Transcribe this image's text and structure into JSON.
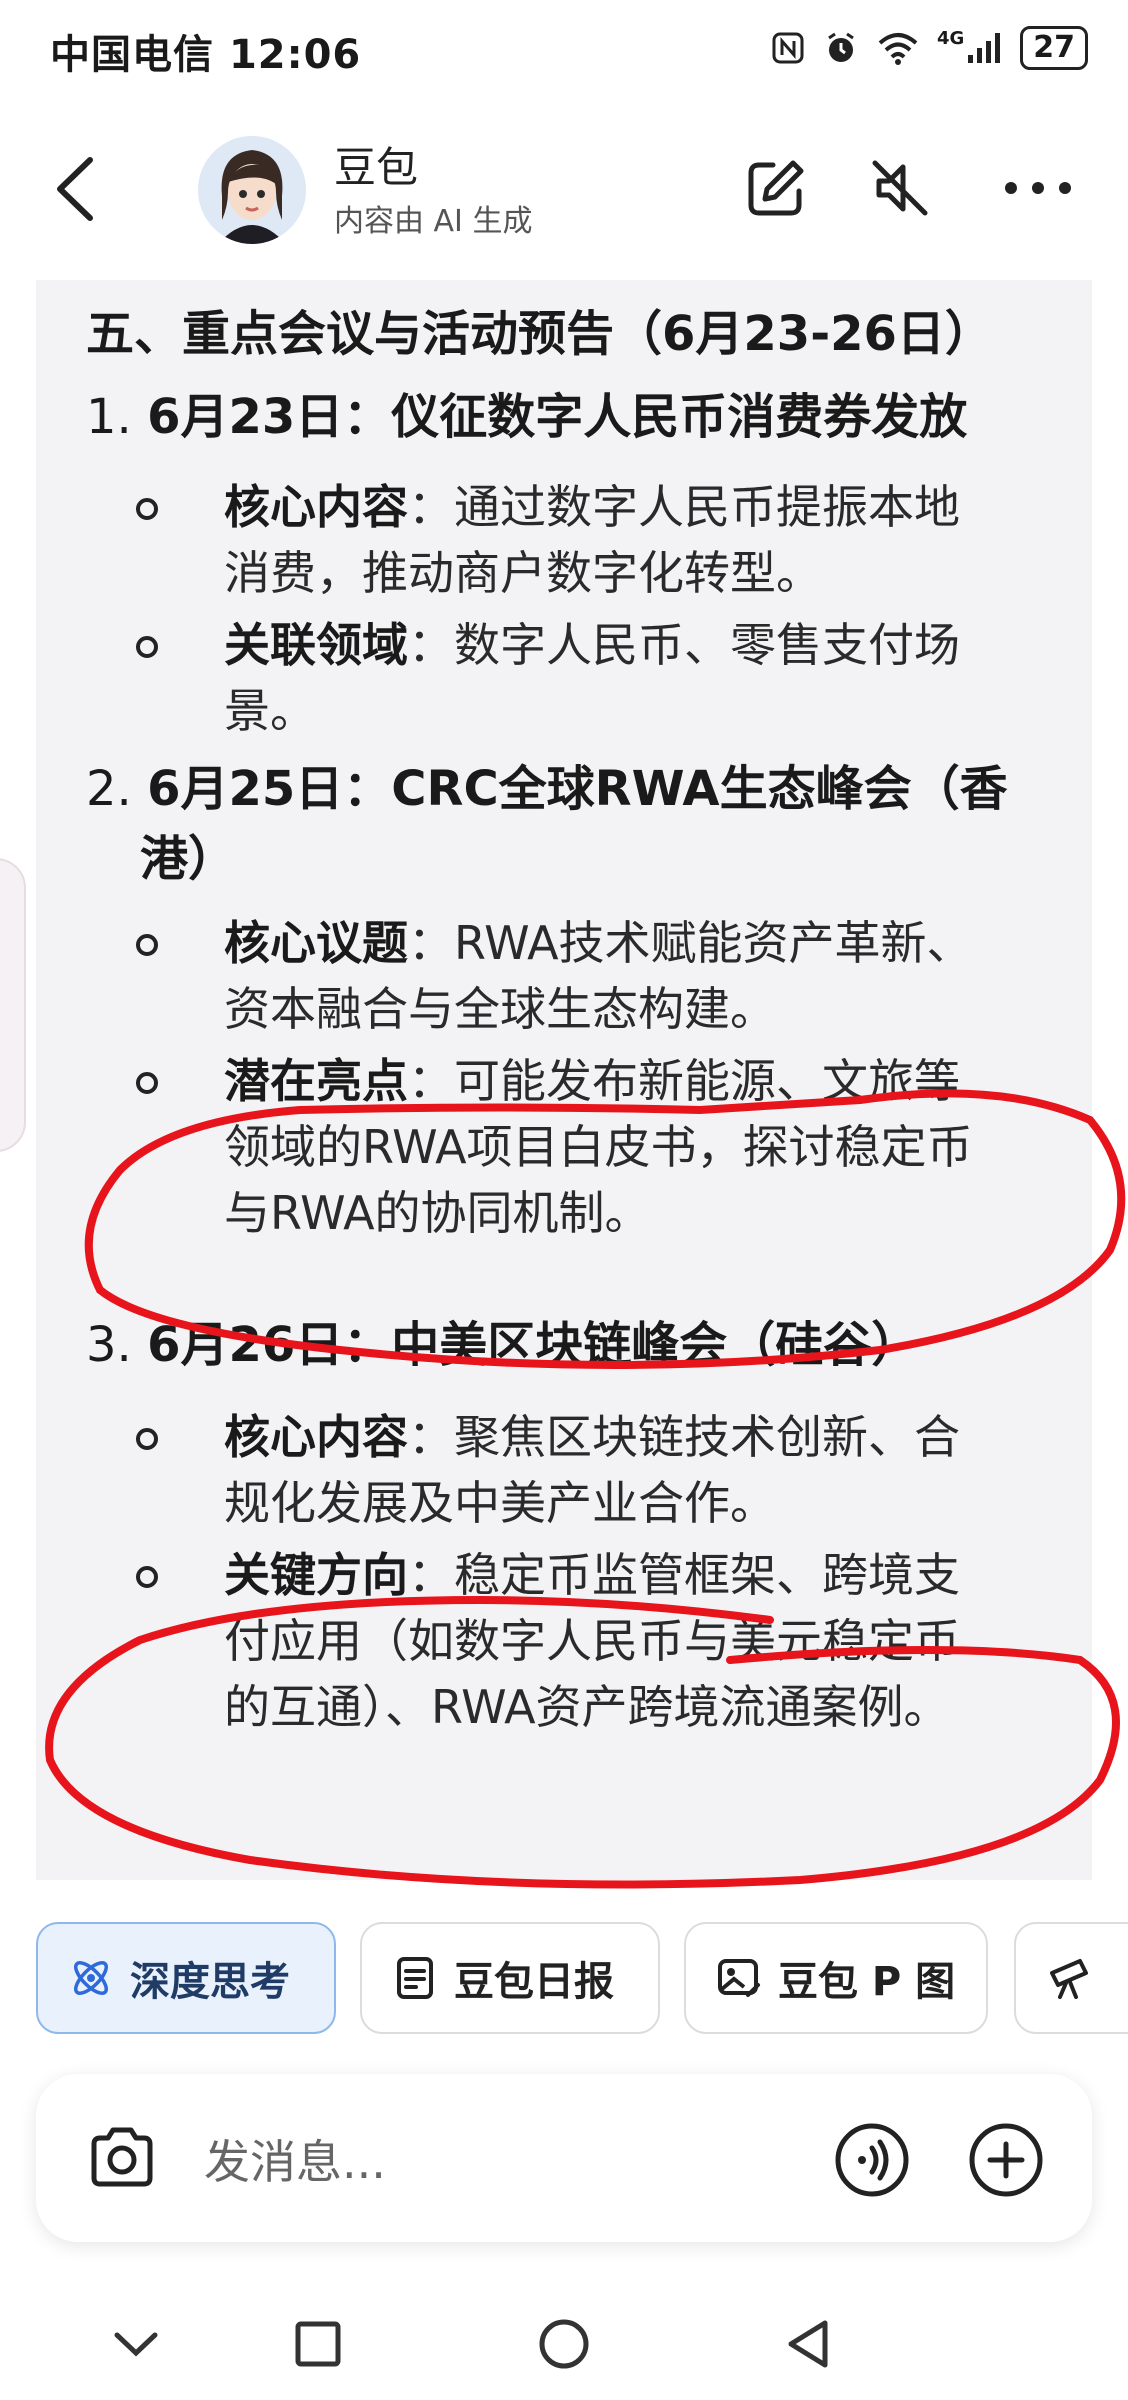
{
  "status_bar": {
    "carrier": "中国电信",
    "time": "12:06",
    "network": "4G",
    "battery": "27"
  },
  "header": {
    "title": "豆包",
    "subtitle": "内容由 AI 生成",
    "back_icon": "back-arrow-icon",
    "edit_icon": "edit-icon",
    "mute_icon": "mute-icon",
    "more_icon": "more-icon"
  },
  "content": {
    "section_title": "五、重点会议与活动预告（6月23-26日）",
    "items": [
      {
        "number": "1.",
        "title": "6月23日：仪征数字人民币消费券发放",
        "bullets": [
          {
            "label": "核心内容",
            "sep": "：",
            "lines": [
              "通过数字人民币提振本地",
              "消费，推动商户数字化转型。"
            ]
          },
          {
            "label": "关联领域",
            "sep": "：",
            "lines": [
              "数字人民币、零售支付场",
              "景。"
            ]
          }
        ]
      },
      {
        "number": "2.",
        "title_line1": "6月25日：CRC全球RWA生态峰会（香",
        "title_line2": "港）",
        "bullets": [
          {
            "label": "核心议题",
            "sep": "：",
            "lines": [
              "RWA技术赋能资产革新、",
              "资本融合与全球生态构建。"
            ]
          },
          {
            "label": "潜在亮点",
            "sep": "：",
            "lines": [
              "可能发布新能源、文旅等",
              "领域的RWA项目白皮书，探讨稳定币",
              "与RWA的协同机制。"
            ]
          }
        ]
      },
      {
        "number": "3.",
        "title": "6月26日：中美区块链峰会（硅谷）",
        "bullets": [
          {
            "label": "核心内容",
            "sep": "：",
            "lines": [
              "聚焦区块链技术创新、合",
              "规化发展及中美产业合作。"
            ]
          },
          {
            "label": "关键方向",
            "sep": "：",
            "lines": [
              "稳定币监管框架、跨境支",
              "付应用（如数字人民币与美元稳定币",
              "的互通）、RWA资产跨境流通案例。"
            ]
          }
        ]
      }
    ]
  },
  "chips": [
    {
      "label": "深度思考",
      "icon": "atom-icon",
      "active": true
    },
    {
      "label": "豆包日报",
      "icon": "document-icon",
      "active": false
    },
    {
      "label": "豆包 P 图",
      "icon": "image-edit-icon",
      "active": false
    },
    {
      "label": "",
      "icon": "telescope-icon",
      "active": false
    }
  ],
  "input": {
    "placeholder": "发消息..."
  },
  "colors": {
    "annotation_red": "#e8141c",
    "chip_active_bg": "#e8f1fc",
    "content_bg": "#f3f3f5"
  }
}
